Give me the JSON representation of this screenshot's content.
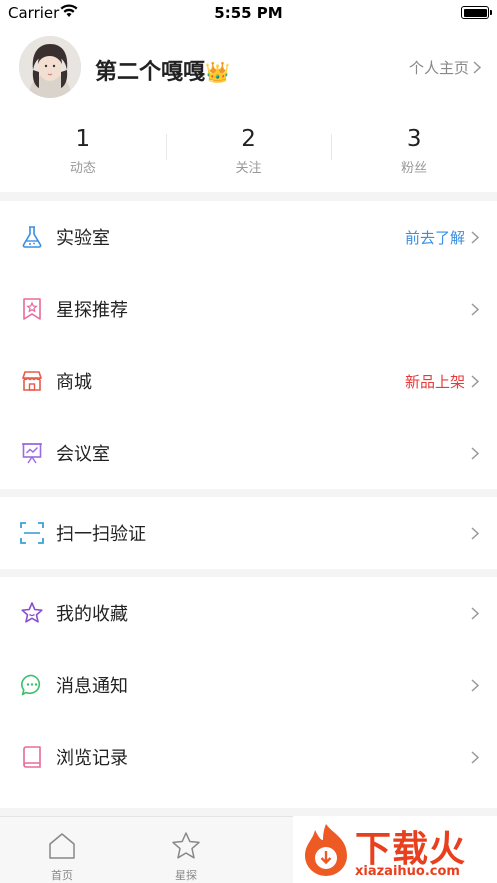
{
  "status_bar": {
    "carrier": "Carrier",
    "time": "5:55 PM"
  },
  "profile": {
    "name": "第二个嘎嘎",
    "name_emoji": "👑",
    "homepage_label": "个人主页",
    "stats": [
      {
        "value": "1",
        "label": "动态"
      },
      {
        "value": "2",
        "label": "关注"
      },
      {
        "value": "3",
        "label": "粉丝"
      }
    ]
  },
  "menu": {
    "lab": {
      "label": "实验室",
      "extra": "前去了解",
      "extra_color": "#3a8ee6",
      "icon": "flask-icon"
    },
    "star": {
      "label": "星探推荐",
      "icon": "star-bookmark-icon"
    },
    "mall": {
      "label": "商城",
      "extra": "新品上架",
      "extra_color": "#e83a3a",
      "icon": "store-icon"
    },
    "meeting": {
      "label": "会议室",
      "icon": "presentation-icon"
    },
    "scan": {
      "label": "扫一扫验证",
      "icon": "scan-icon"
    },
    "favorites": {
      "label": "我的收藏",
      "icon": "star-icon"
    },
    "notify": {
      "label": "消息通知",
      "icon": "chat-bubble-icon"
    },
    "history": {
      "label": "浏览记录",
      "icon": "book-icon"
    }
  },
  "tabbar": {
    "items": [
      {
        "label": "首页",
        "icon": "home-icon"
      },
      {
        "label": "星探",
        "icon": "star-outline-icon"
      }
    ]
  },
  "watermark": {
    "text": "下载火",
    "url": "xiazaihuo.com"
  },
  "colors": {
    "accent_blue": "#3a8ee6",
    "accent_red": "#e83a3a",
    "background": "#f4f4f4"
  }
}
